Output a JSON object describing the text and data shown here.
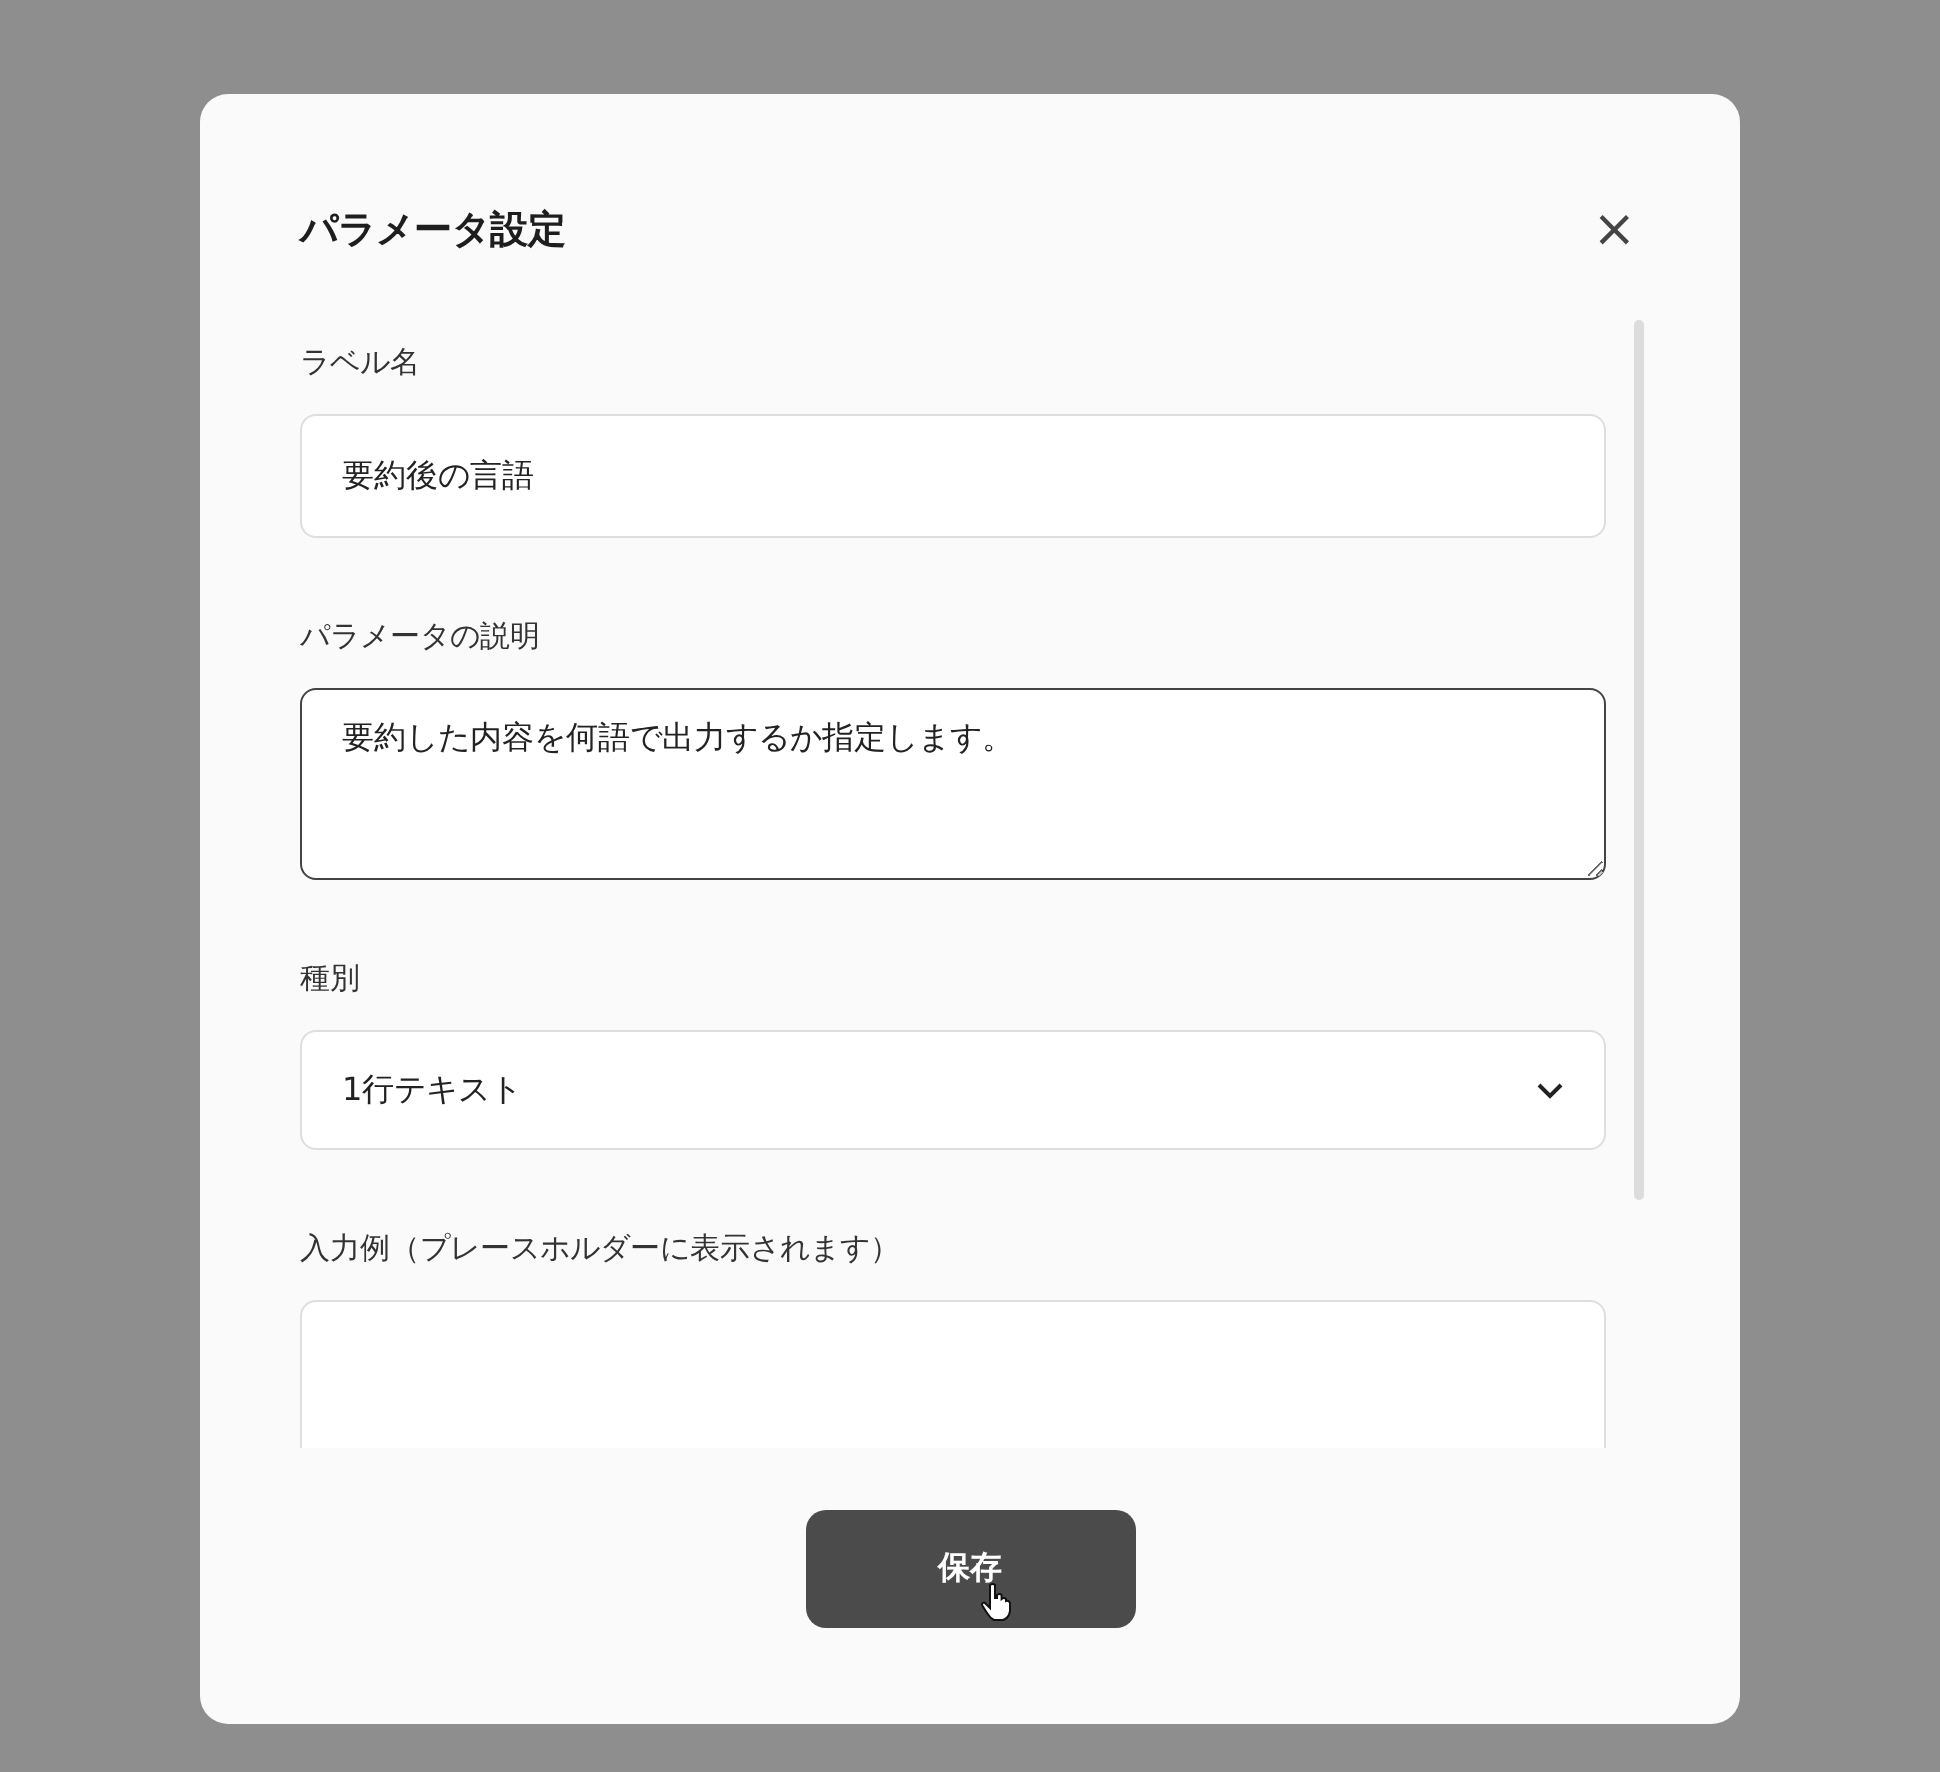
{
  "dialog": {
    "title": "パラメータ設定",
    "close": "×",
    "fields": [
      {
        "kind": "text",
        "label": "ラベル名",
        "value": "要約後の言語",
        "focused": false
      },
      {
        "kind": "textarea",
        "label": "パラメータの説明",
        "value": "要約した内容を何語で出力するか指定します。",
        "focused": true
      },
      {
        "kind": "select",
        "label": "種別",
        "value": "1行テキスト",
        "focused": false
      },
      {
        "kind": "textarea",
        "label": "入力例（プレースホルダーに表示されます）",
        "focused": false
      }
    ],
    "save_button": "保存"
  }
}
